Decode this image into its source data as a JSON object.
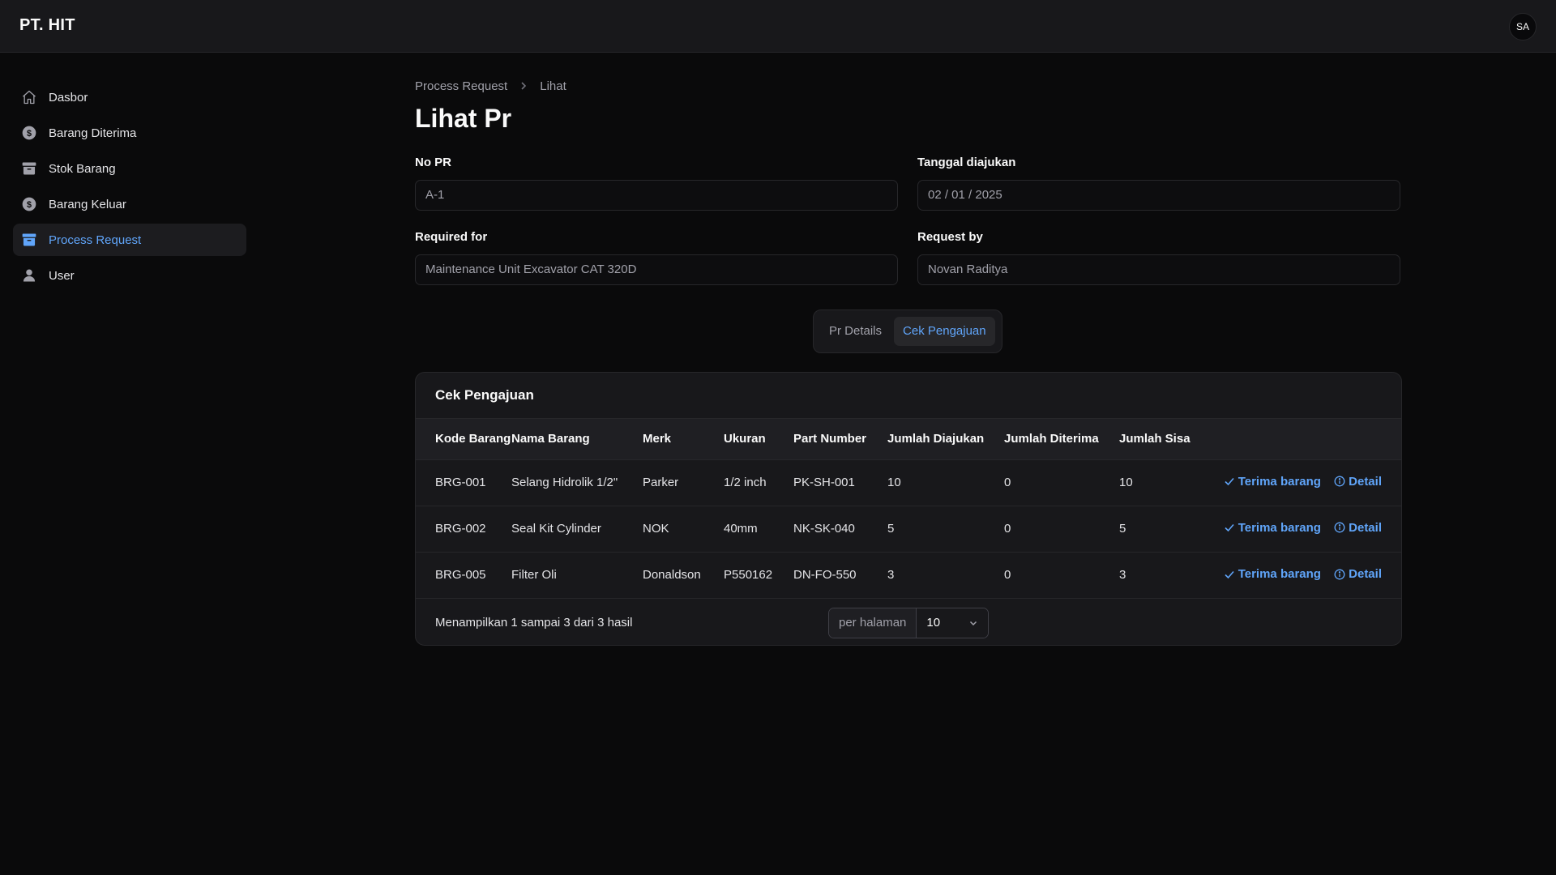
{
  "app": {
    "brand": "PT. HIT",
    "avatar_initials": "SA"
  },
  "sidebar": {
    "items": [
      {
        "label": "Dasbor",
        "icon": "home-icon"
      },
      {
        "label": "Barang Diterima",
        "icon": "dollar-circle-icon"
      },
      {
        "label": "Stok Barang",
        "icon": "archive-box-icon"
      },
      {
        "label": "Barang Keluar",
        "icon": "dollar-circle-icon"
      },
      {
        "label": "Process Request",
        "icon": "archive-box-icon",
        "active": true
      },
      {
        "label": "User",
        "icon": "user-icon"
      }
    ]
  },
  "breadcrumb": {
    "parent": "Process Request",
    "current": "Lihat"
  },
  "page": {
    "title": "Lihat Pr"
  },
  "form": {
    "no_pr": {
      "label": "No PR",
      "value": "A-1"
    },
    "tanggal": {
      "label": "Tanggal diajukan",
      "value": "02 / 01 / 2025"
    },
    "required_for": {
      "label": "Required for",
      "value": "Maintenance Unit Excavator CAT 320D"
    },
    "request_by": {
      "label": "Request by",
      "value": "Novan Raditya"
    }
  },
  "tabs": {
    "items": [
      "Pr Details",
      "Cek Pengajuan"
    ],
    "active": "Cek Pengajuan"
  },
  "table": {
    "title": "Cek Pengajuan",
    "columns": [
      "Kode Barang",
      "Nama Barang",
      "Merk",
      "Ukuran",
      "Part Number",
      "Jumlah Diajukan",
      "Jumlah Diterima",
      "Jumlah Sisa"
    ],
    "rows": [
      {
        "kode": "BRG-001",
        "nama": "Selang Hidrolik 1/2\"",
        "merk": "Parker",
        "ukuran": "1/2 inch",
        "part": "PK-SH-001",
        "diajukan": "10",
        "diterima": "0",
        "sisa": "10"
      },
      {
        "kode": "BRG-002",
        "nama": "Seal Kit Cylinder",
        "merk": "NOK",
        "ukuran": "40mm",
        "part": "NK-SK-040",
        "diajukan": "5",
        "diterima": "0",
        "sisa": "5"
      },
      {
        "kode": "BRG-005",
        "nama": "Filter Oli",
        "merk": "Donaldson",
        "ukuran": "P550162",
        "part": "DN-FO-550",
        "diajukan": "3",
        "diterima": "0",
        "sisa": "3"
      }
    ],
    "actions": {
      "accept": "Terima barang",
      "detail": "Detail"
    },
    "summary": "Menampilkan 1 sampai 3 dari 3 hasil",
    "per_page_label": "per halaman",
    "per_page_value": "10"
  },
  "colors": {
    "accent": "#60a5fa",
    "background": "#0a0a0b",
    "surface": "#18181b",
    "border": "#27272a"
  }
}
